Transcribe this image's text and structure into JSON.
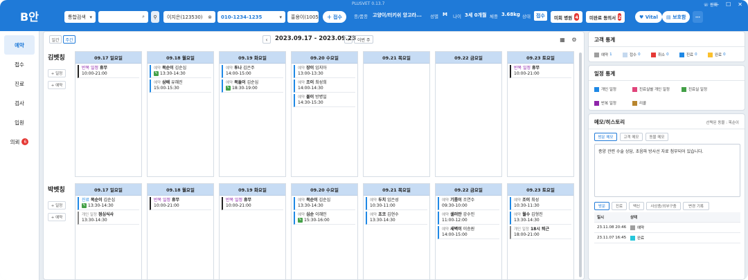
{
  "app": {
    "logo": "B안",
    "title": "PLUSVET",
    "version": "0.13.7",
    "account": "원회"
  },
  "header": {
    "search_scope": "통합검색",
    "search_value": "",
    "owner": "이지은(123530)",
    "phone": "010-1234-1235",
    "animal": "홍용이(100504)",
    "register_label": "접수",
    "species_label": "종/품종",
    "species_value": "고양이/터키쉬 앙고라...",
    "sex_label": "성별",
    "sex_value": "M",
    "age_label": "나이",
    "age_value": "3세 0개월",
    "weight_label": "체중",
    "weight_value": "3.68kg",
    "status_label": "상태",
    "status_value": "접수",
    "unpaid_label": "미회 병원",
    "unpaid_count": "4",
    "consent_label": "미완료 동의서",
    "consent_count": "2",
    "vital_label": "Vital",
    "guardian_label": "보호함"
  },
  "sidebar": {
    "items": [
      {
        "label": "예약",
        "active": true
      },
      {
        "label": "접수"
      },
      {
        "label": "진료"
      },
      {
        "label": "검사"
      },
      {
        "label": "입원"
      },
      {
        "label": "의뢰",
        "badge": "6"
      }
    ]
  },
  "calendar": {
    "view_day": "일간",
    "view_week": "주간",
    "range": "2023.09.17 - 2023.09.23",
    "this_week": "이번 주",
    "add_schedule": "+ 일정",
    "add_reservation": "+ 예약",
    "days": [
      "09.17 일요일",
      "09.18 월요일",
      "09.19 화요일",
      "09.20 수요일",
      "09.21 목요일",
      "09.22 금요일",
      "09.23 토요일"
    ],
    "staff": [
      {
        "name": "김벳칭",
        "days": [
          [
            {
              "kind": "rep",
              "tag": "반복 일정",
              "name": "휴무",
              "time": "10:00-21:00"
            }
          ],
          [
            {
              "kind": "res",
              "tag": "예약",
              "name": "목순이",
              "owner": "김순심",
              "time": "13:30-14:30",
              "icon": true
            },
            {
              "kind": "res",
              "tag": "예약",
              "name": "삼배",
              "owner": "유혜진",
              "time": "15:00-15:30"
            }
          ],
          [
            {
              "kind": "res",
              "tag": "예약",
              "name": "투나",
              "owner": "김은주",
              "time": "14:00-15:00"
            },
            {
              "kind": "res",
              "tag": "예약",
              "name": "복돌이",
              "owner": "김순심",
              "time": "18:30-19:00",
              "icon": true
            }
          ],
          [
            {
              "kind": "res",
              "tag": "예약",
              "name": "장이",
              "owner": "임지아",
              "time": "13:00-13:30"
            },
            {
              "kind": "res",
              "tag": "예약",
              "name": "조이",
              "owner": "최성희",
              "time": "14:00-14:30"
            },
            {
              "kind": "res",
              "tag": "예약",
              "name": "몰이",
              "owner": "방병일",
              "time": "14:30-15:30"
            }
          ],
          [],
          [],
          [
            {
              "kind": "rep",
              "tag": "반복 일정",
              "name": "휴무",
              "time": "10:00-21:00"
            }
          ]
        ]
      },
      {
        "name": "박벳칭",
        "days": [
          [
            {
              "kind": "gen",
              "tag": "진료",
              "name": "목순이",
              "owner": "김순심",
              "time": "13:30-14:30",
              "icon": true
            },
            {
              "kind": "per",
              "tag": "개인 일정",
              "name": "점심식사",
              "time": "13:30-14:30"
            }
          ],
          [
            {
              "kind": "rep",
              "tag": "반복 일정",
              "name": "휴무",
              "time": "10:00-21:00"
            }
          ],
          [
            {
              "kind": "rep",
              "tag": "반복 일정",
              "name": "휴무",
              "time": "10:00-21:00"
            }
          ],
          [
            {
              "kind": "res",
              "tag": "예약",
              "name": "목순이",
              "owner": "김순심",
              "time": "13:30-14:30"
            },
            {
              "kind": "res",
              "tag": "예약",
              "name": "심순",
              "owner": "이혜인",
              "time": "15:30-16:00",
              "icon": true
            }
          ],
          [
            {
              "kind": "res",
              "tag": "예약",
              "name": "두치",
              "owner": "임은성",
              "time": "10:30-11:00"
            },
            {
              "kind": "res",
              "tag": "예약",
              "name": "초코",
              "owner": "김현수",
              "time": "13:30-14:30"
            }
          ],
          [
            {
              "kind": "res",
              "tag": "예약",
              "name": "기름이",
              "owner": "조연수",
              "time": "09:30-10:00"
            },
            {
              "kind": "res",
              "tag": "예약",
              "name": "샐러만",
              "owner": "강수민",
              "time": "11:00-12:00"
            },
            {
              "kind": "res",
              "tag": "예약",
              "name": "새벽이",
              "owner": "이승원",
              "time": "14:00-15:00"
            }
          ],
          [
            {
              "kind": "res",
              "tag": "예약",
              "name": "조이",
              "owner": "최성",
              "time": "10:30-11:30"
            },
            {
              "kind": "res",
              "tag": "예약",
              "name": "월수",
              "owner": "김형진",
              "time": "13:30-14:30"
            },
            {
              "kind": "per",
              "tag": "개인 일정",
              "name": "18시 퇴근",
              "time": "18:00-21:00"
            }
          ]
        ]
      }
    ]
  },
  "customer_stats": {
    "title": "고객 통계",
    "items": [
      {
        "label": "예약",
        "count": "1",
        "color": "#9e9e9e"
      },
      {
        "label": "접수",
        "count": "0",
        "color": "#c5d9ef"
      },
      {
        "label": "취소",
        "count": "0",
        "color": "#e53935"
      },
      {
        "label": "진료",
        "count": "0",
        "color": "#1e88e5"
      },
      {
        "label": "완료",
        "count": "0",
        "color": "#fbc02d"
      }
    ]
  },
  "schedule_stats": {
    "title": "일정 통계",
    "items": [
      {
        "label": "개인 일정",
        "color": "#1e88e5"
      },
      {
        "label": "진료실별 개인 일정",
        "color": "#e0457b"
      },
      {
        "label": "진료실 일정",
        "color": "#43a047"
      },
      {
        "label": "반복 일정",
        "color": "#8e24aa"
      },
      {
        "label": "리콜",
        "color": "#b8862f"
      }
    ]
  },
  "memo": {
    "title": "메모/히스토리",
    "selected_label": "선택된 동물 : 목순이",
    "tabs": [
      "방문 메모",
      "고객 메모",
      "동물 메모"
    ],
    "text": "종양 관련 수술 상담, 초음파 방사선 자료 첨부되어 있습니다.",
    "hist_tabs": [
      "방문",
      "진료",
      "백신",
      "사상충/외부구충",
      "변경 기록"
    ],
    "hist_headers": [
      "일시",
      "상태"
    ],
    "hist_rows": [
      {
        "date": "23.11.08 20:46",
        "status": "예약",
        "color": "#9e9e9e"
      },
      {
        "date": "23.11.07 16:45",
        "status": "완료",
        "color": "#26c6da"
      }
    ]
  }
}
